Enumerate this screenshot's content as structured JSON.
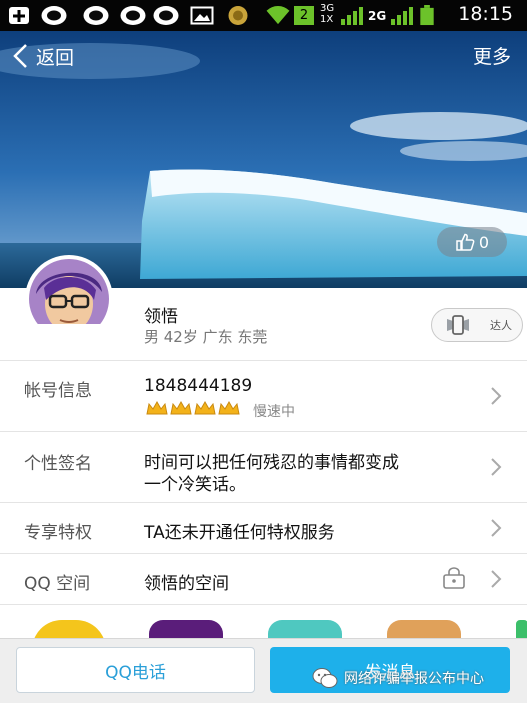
{
  "status_bar": {
    "time": "18:15",
    "network_top": "3G",
    "network_bottom": "1X",
    "network_2g": "2G",
    "sim_badge": "2",
    "icons": [
      "add-box-icon",
      "qq-icon",
      "qq-icon",
      "qq-icon",
      "qq-icon",
      "image-icon",
      "coin-icon",
      "wifi-icon",
      "signal-icon",
      "battery-icon"
    ]
  },
  "header": {
    "back_label": "返回",
    "more_label": "更多"
  },
  "cover": {
    "like_count": "0"
  },
  "profile": {
    "name": "领悟",
    "details": "男  42岁  广东  东莞",
    "daren_label": "达人"
  },
  "rows": {
    "account": {
      "label": "帐号信息",
      "value": "1848444189",
      "crown_count": 4,
      "speed_label": "慢速中"
    },
    "signature": {
      "label": "个性签名",
      "line1": "时间可以把任何残忍的事情都变成",
      "line2": "一个冷笑话。"
    },
    "privilege": {
      "label": "专享特权",
      "value": "TA还未开通任何特权服务"
    },
    "qzone": {
      "label": "QQ 空间",
      "value": "领悟的空间"
    }
  },
  "actions": {
    "call_label": "QQ电话",
    "message_label": "发消息"
  },
  "watermark": {
    "text": "网络诈骗举报公布中心"
  },
  "colors": {
    "accent": "#1eb0ea",
    "call_text": "#2a9fd8",
    "status_bar_bg": "#050505"
  }
}
